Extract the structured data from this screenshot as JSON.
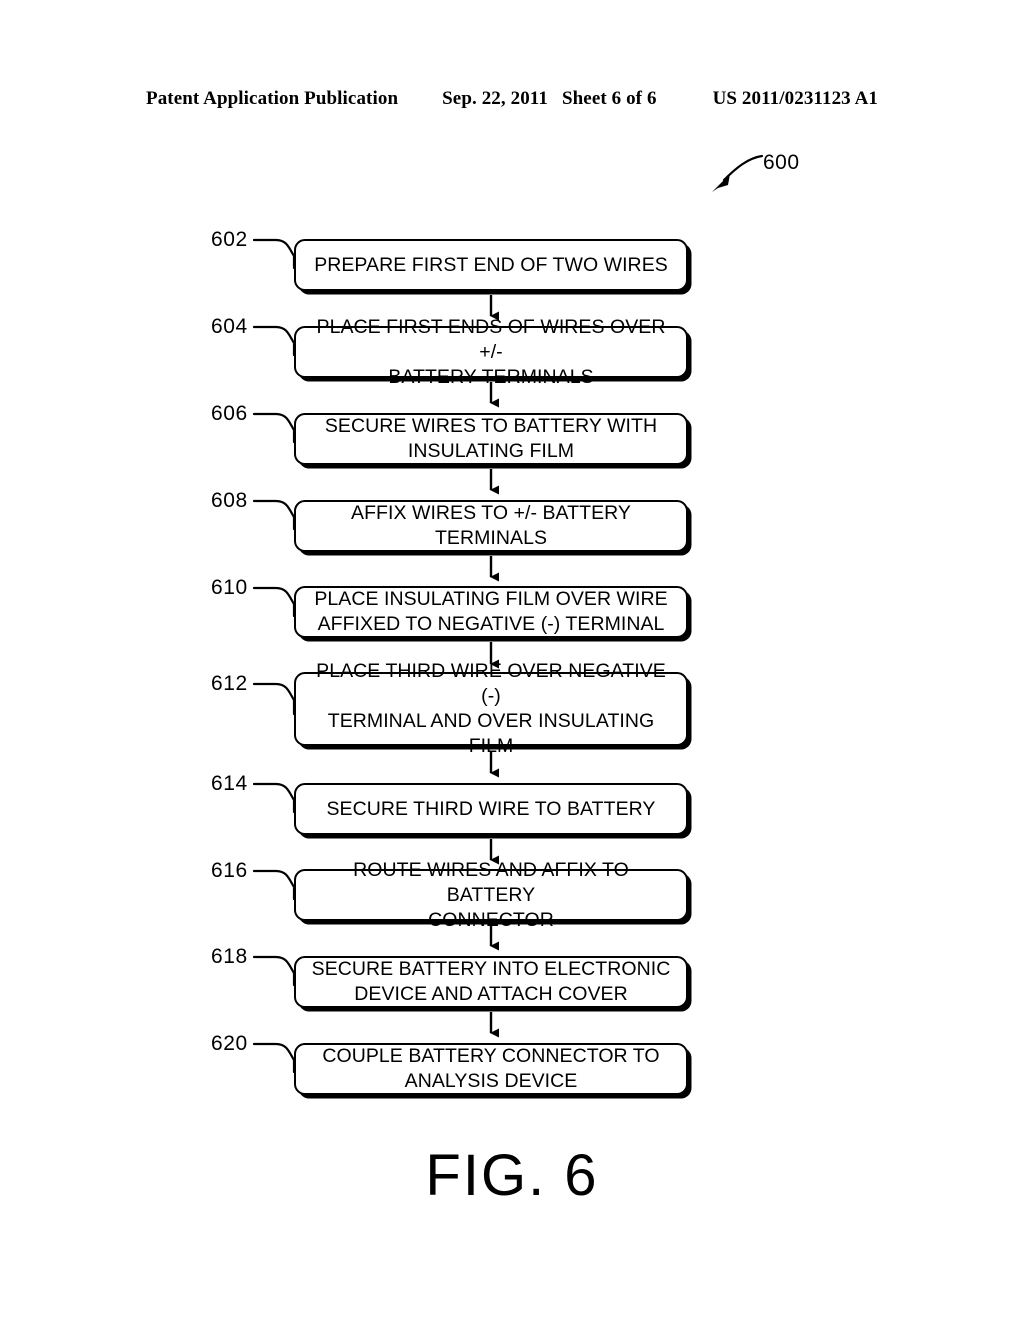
{
  "header": {
    "publication": "Patent Application Publication",
    "date": "Sep. 22, 2011",
    "sheet": "Sheet 6 of 6",
    "number": "US 2011/0231123 A1"
  },
  "figure": {
    "reference_number": "600",
    "caption": "FIG. 6"
  },
  "flowchart": {
    "type": "flowchart",
    "orientation": "vertical",
    "steps": [
      {
        "number": "602",
        "text": "PREPARE FIRST END OF TWO WIRES"
      },
      {
        "number": "604",
        "text": "PLACE FIRST ENDS OF WIRES OVER +/-\nBATTERY TERMINALS"
      },
      {
        "number": "606",
        "text": "SECURE WIRES TO BATTERY WITH\nINSULATING FILM"
      },
      {
        "number": "608",
        "text": "AFFIX WIRES TO +/- BATTERY TERMINALS"
      },
      {
        "number": "610",
        "text": "PLACE INSULATING FILM OVER WIRE\nAFFIXED TO NEGATIVE (-) TERMINAL"
      },
      {
        "number": "612",
        "text": "PLACE THIRD WIRE OVER NEGATIVE (-)\nTERMINAL AND OVER INSULATING FILM"
      },
      {
        "number": "614",
        "text": "SECURE THIRD WIRE TO BATTERY"
      },
      {
        "number": "616",
        "text": "ROUTE WIRES AND AFFIX TO BATTERY\nCONNECTOR"
      },
      {
        "number": "618",
        "text": "SECURE BATTERY INTO ELECTRONIC\nDEVICE AND ATTACH COVER"
      },
      {
        "number": "620",
        "text": "COUPLE BATTERY CONNECTOR TO\nANALYSIS DEVICE"
      }
    ]
  },
  "colors": {
    "ink": "#000000",
    "page": "#ffffff"
  }
}
